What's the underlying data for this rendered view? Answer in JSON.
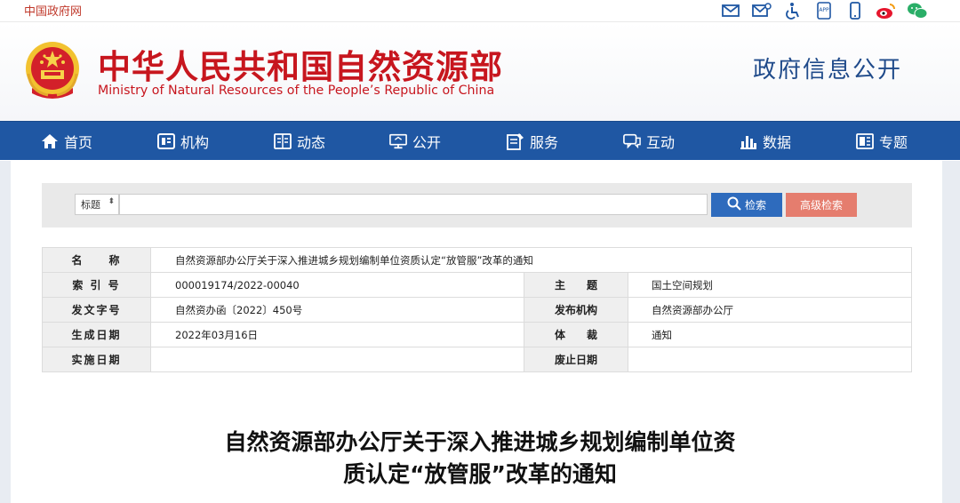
{
  "topbar": {
    "gov_link": "中国政府网",
    "icons": [
      "mail-icon",
      "mailbox-icon",
      "accessibility-icon",
      "app-icon",
      "mobile-icon",
      "weibo-icon",
      "wechat-icon"
    ]
  },
  "header": {
    "title_cn": "中华人民共和国自然资源部",
    "title_en": "Ministry of Natural Resources of the People’s Republic of China",
    "info_open": "政府信息公开"
  },
  "nav": {
    "items": [
      {
        "label": "首页",
        "icon": "home-icon"
      },
      {
        "label": "机构",
        "icon": "organization-icon"
      },
      {
        "label": "动态",
        "icon": "news-icon"
      },
      {
        "label": "公开",
        "icon": "disclosure-icon"
      },
      {
        "label": "服务",
        "icon": "service-icon"
      },
      {
        "label": "互动",
        "icon": "interaction-icon"
      },
      {
        "label": "数据",
        "icon": "data-icon"
      },
      {
        "label": "专题",
        "icon": "topic-icon"
      }
    ]
  },
  "search": {
    "field_select": "标题",
    "search_button": "检索",
    "advanced_button": "高级检索",
    "input_value": ""
  },
  "meta": {
    "name_label": "名　　称",
    "name_value": "自然资源部办公厅关于深入推进城乡规划编制单位资质认定“放管服”改革的通知",
    "index_label": "索 引 号",
    "index_value": "000019174/2022-00040",
    "subject_label": "主　　题",
    "subject_value": "国土空间规划",
    "docno_label": "发文字号",
    "docno_value": "自然资办函〔2022〕450号",
    "publisher_label": "发布机构",
    "publisher_value": "自然资源部办公厅",
    "created_label": "生成日期",
    "created_value": "2022年03月16日",
    "genre_label": "体　　裁",
    "genre_value": "通知",
    "effective_label": "实施日期",
    "effective_value": "",
    "repeal_label": "废止日期",
    "repeal_value": ""
  },
  "document": {
    "title_line1": "自然资源部办公厅关于深入推进城乡规划编制单位资",
    "title_line2": "质认定“放管服”改革的通知"
  },
  "colors": {
    "brand_red": "#c7161e",
    "nav_blue": "#1f57a3",
    "search_blue": "#2e6bbd",
    "advanced_red": "#e57d6e"
  }
}
